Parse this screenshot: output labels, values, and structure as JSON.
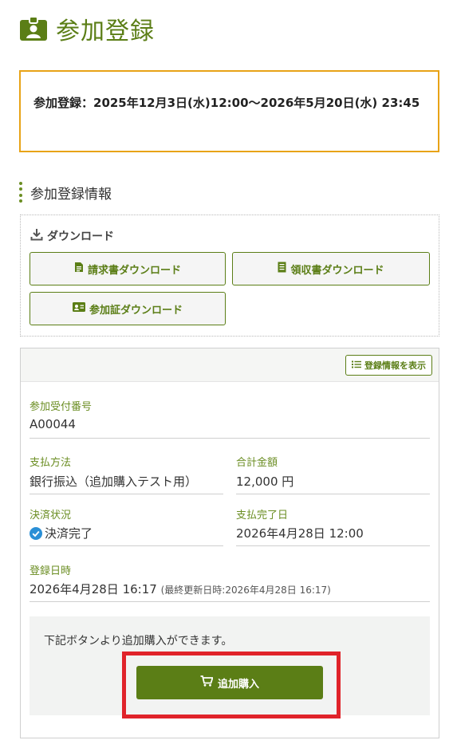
{
  "page": {
    "title": "参加登録"
  },
  "period": {
    "text": "参加登録：2025年12月3日(水)12:00〜2026年5月20日(水) 23:45"
  },
  "section": {
    "title": "参加登録情報"
  },
  "downloads": {
    "heading": "ダウンロード",
    "invoice_label": "請求書ダウンロード",
    "receipt_label": "領収書ダウンロード",
    "certificate_label": "参加証ダウンロード"
  },
  "card": {
    "show_info_label": "登録情報を表示",
    "receipt_number": {
      "label": "参加受付番号",
      "value": "A00044"
    },
    "payment_method": {
      "label": "支払方法",
      "value": "銀行振込（追加購入テスト用）"
    },
    "total": {
      "label": "合計金額",
      "value": "12,000 円"
    },
    "payment_status": {
      "label": "決済状況",
      "value": "決済完了"
    },
    "payment_date": {
      "label": "支払完了日",
      "value": "2026年4月28日 12:00"
    },
    "registered_at": {
      "label": "登録日時",
      "value": "2026年4月28日 16:17",
      "updated_note": "(最終更新日時:2026年4月28日 16:17)"
    }
  },
  "purchase": {
    "message": "下記ボタンより追加購入ができます。",
    "button_label": "追加購入"
  },
  "colors": {
    "brand_green": "#5b7e16",
    "period_border": "#e8a317",
    "highlight_red": "#e0232a",
    "status_blue": "#2a8fd6"
  },
  "icons": [
    "id-badge-icon",
    "download-icon",
    "invoice-file-icon",
    "receipt-icon",
    "id-card-icon",
    "list-icon",
    "check-circle-icon",
    "cart-icon"
  ]
}
